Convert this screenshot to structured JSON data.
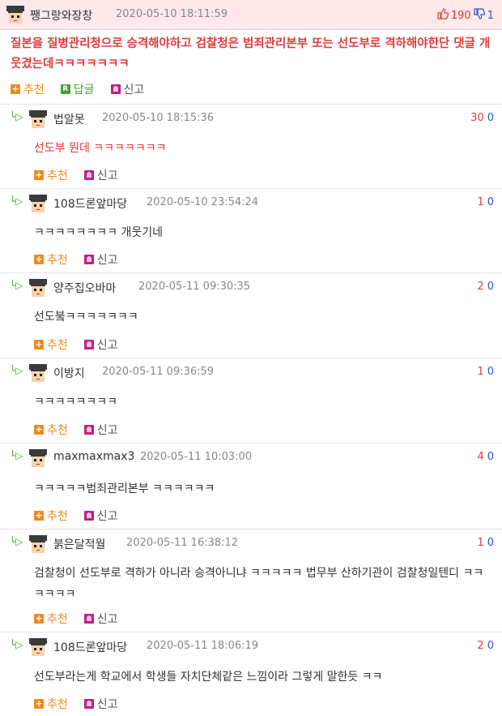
{
  "post": {
    "author": "쨍그랑와장창",
    "date": "2020-05-10 18:11:59",
    "upvotes": "190",
    "downvotes": "1",
    "body": "질본을 질병관리청으로 승격해야하고 검찰청은 범죄관리본부 또는 선도부로 격하해야한단 댓글 개웃겼는데ㅋㅋㅋㅋㅋㅋㅋ",
    "actions": {
      "recommend": "추천",
      "reply": "답글",
      "report": "신고"
    }
  },
  "actions": {
    "recommend": "추천",
    "report": "신고"
  },
  "replies": [
    {
      "author": "법알못",
      "date": "2020-05-10 18:15:36",
      "up": "30",
      "down": "0",
      "body": "선도부 뭔데 ㅋㅋㅋㅋㅋㅋㅋ"
    },
    {
      "author": "108드론앞마당",
      "date": "2020-05-10 23:54:24",
      "up": "1",
      "down": "0",
      "body": "ㅋㅋㅋㅋㅋㅋㅋㅋ 개웃기네"
    },
    {
      "author": "양주집오바마",
      "date": "2020-05-11 09:30:35",
      "up": "2",
      "down": "0",
      "body": "선도붘ㅋㅋㅋㅋㅋㅋㅋ"
    },
    {
      "author": "이방지",
      "date": "2020-05-11 09:36:59",
      "up": "1",
      "down": "0",
      "body": "ㅋㅋㅋㅋㅋㅋㅋㅋ"
    },
    {
      "author": "maxmaxmax3",
      "date": "2020-05-11 10:03:00",
      "up": "4",
      "down": "0",
      "body": "ㅋㅋㅋㅋㅋ범죄관리본부 ㅋㅋㅋㅋㅋㅋ"
    },
    {
      "author": "붉은달적월",
      "date": "2020-05-11 16:38:12",
      "up": "1",
      "down": "0",
      "body": "검찰청이 선도부로 격하가 아니라 승격아니냐 ㅋㅋㅋㅋㅋ 법무부 산하기관이 검찰청일텐디 ㅋㅋㅋㅋㅋㅋ"
    },
    {
      "author": "108드론앞마당",
      "date": "2020-05-11 18:06:19",
      "up": "2",
      "down": "0",
      "body": "선도부라는게 학교에서 학생들 자치단체같은 느낌이라 그렇게 말한듯 ㅋㅋ"
    }
  ]
}
